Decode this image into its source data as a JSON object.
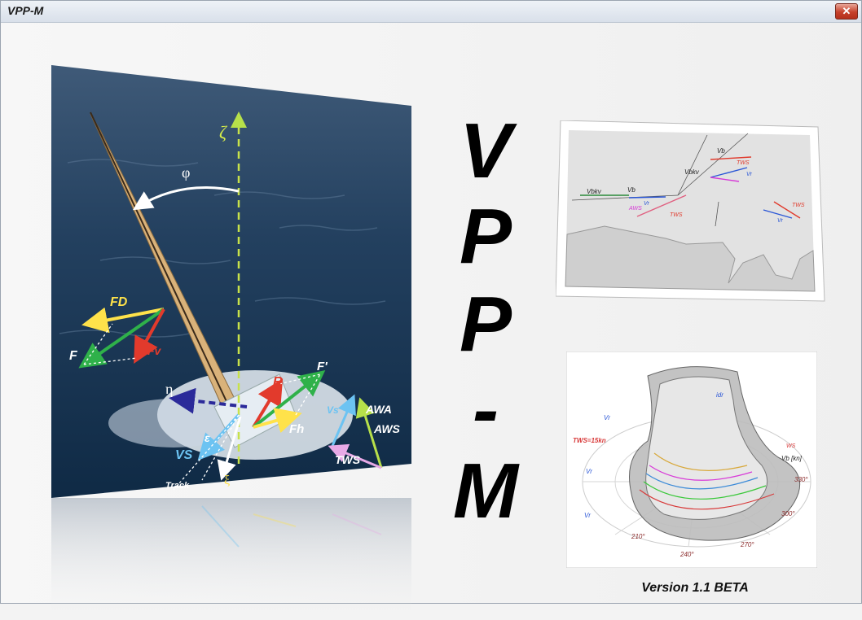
{
  "window": {
    "title": "VPP-M",
    "close_label": "✕"
  },
  "logo": {
    "letters": [
      "V",
      "P",
      "P",
      "-",
      "M"
    ]
  },
  "photo_labels": {
    "zeta": "ζ",
    "phi": "φ",
    "fd": "FD",
    "f": "F",
    "fv": "Fv",
    "r": "R",
    "fprime": "F'",
    "fh": "Fh",
    "eta": "η",
    "vs": "VS",
    "eps": "ε",
    "xi": "ξ",
    "track": "Track",
    "vs_small": "Vs",
    "awa": "AWA",
    "aws": "AWS",
    "tws": "TWS"
  },
  "diagram1_labels": {
    "vb": "Vb",
    "vbkv": "Vbkv",
    "vb2": "Vb",
    "vr": "Vr",
    "vr2": "Vr",
    "vr3": "Vr",
    "tws1": "TWS",
    "tws2": "TWS",
    "tws3": "TWS",
    "aws": "AWS"
  },
  "diagram2_labels": {
    "tws": "TWS=15kn",
    "vr1": "Vr",
    "vr2": "Vr",
    "vr3": "Vr",
    "vb": "Vb [kn]",
    "idr": "idr",
    "ws": "WS",
    "a210": "210°",
    "a240": "240°",
    "a270": "270°",
    "a300": "300°",
    "a330": "330°"
  },
  "version": "Version 1.1 BETA"
}
